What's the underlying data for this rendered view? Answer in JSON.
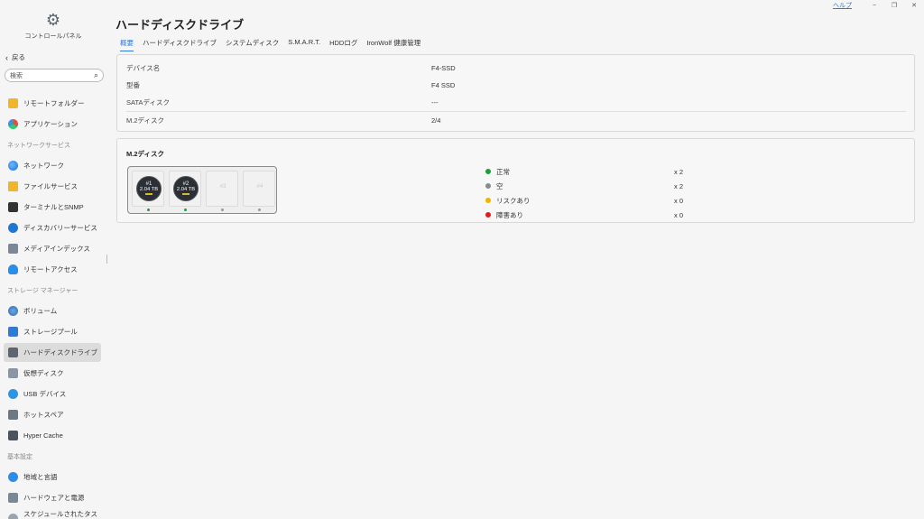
{
  "window": {
    "help": "ヘルプ",
    "minimize": "−",
    "restore": "❐",
    "close": "✕"
  },
  "sidebar": {
    "title": "コントロールパネル",
    "back": "戻る",
    "search_placeholder": "検索",
    "items": [
      {
        "type": "item",
        "label": "リモートフォルダー",
        "icon": "remote-folder-icon",
        "cls": "yellow"
      },
      {
        "type": "item",
        "label": "アプリケーション",
        "icon": "app-icon",
        "cls": "tri"
      },
      {
        "type": "section",
        "label": "ネットワークサービス"
      },
      {
        "type": "item",
        "label": "ネットワーク",
        "icon": "network-icon",
        "cls": "globe"
      },
      {
        "type": "item",
        "label": "ファイルサービス",
        "icon": "file-service-icon",
        "cls": "folder"
      },
      {
        "type": "item",
        "label": "ターミナルとSNMP",
        "icon": "terminal-icon",
        "cls": "term"
      },
      {
        "type": "item",
        "label": "ディスカバリーサービス",
        "icon": "discovery-icon",
        "cls": "disc"
      },
      {
        "type": "item",
        "label": "メディアインデックス",
        "icon": "media-index-icon",
        "cls": "media"
      },
      {
        "type": "item",
        "label": "リモートアクセス",
        "icon": "remote-access-icon",
        "cls": "cloud"
      },
      {
        "type": "section",
        "label": "ストレージ マネージャー"
      },
      {
        "type": "item",
        "label": "ボリューム",
        "icon": "volume-icon",
        "cls": "vol"
      },
      {
        "type": "item",
        "label": "ストレージプール",
        "icon": "storage-pool-icon",
        "cls": "pool"
      },
      {
        "type": "item",
        "label": "ハードディスクドライブ",
        "icon": "hdd-icon",
        "cls": "hdd",
        "active": true
      },
      {
        "type": "item",
        "label": "仮想ディスク",
        "icon": "virtual-disk-icon",
        "cls": "vdisk"
      },
      {
        "type": "item",
        "label": "USB デバイス",
        "icon": "usb-icon",
        "cls": "usb"
      },
      {
        "type": "item",
        "label": "ホットスペア",
        "icon": "hot-spare-icon",
        "cls": "spare"
      },
      {
        "type": "item",
        "label": "Hyper Cache",
        "icon": "hyper-cache-icon",
        "cls": "cache"
      },
      {
        "type": "section",
        "label": "基本設定"
      },
      {
        "type": "item",
        "label": "地域と言語",
        "icon": "region-icon",
        "cls": "region"
      },
      {
        "type": "item",
        "label": "ハードウェアと電源",
        "icon": "hardware-icon",
        "cls": "hw"
      },
      {
        "type": "item",
        "label": "スケジュールされたタスク",
        "icon": "schedule-icon",
        "cls": "sched"
      }
    ]
  },
  "main": {
    "title": "ハードディスクドライブ",
    "tabs": [
      "概要",
      "ハードディスクドライブ",
      "システムディスク",
      "S.M.A.R.T.",
      "HDDログ",
      "IronWolf 健康管理"
    ],
    "active_tab": 0,
    "info": [
      {
        "key": "デバイス名",
        "value": "F4-SSD"
      },
      {
        "key": "型番",
        "value": "F4 SSD"
      },
      {
        "key": "SATAディスク",
        "value": "---"
      },
      {
        "key": "M.2ディスク",
        "value": "2/4"
      }
    ],
    "m2": {
      "heading": "M.2ディスク",
      "slots": [
        {
          "num": "#1",
          "cap": "2.04 TB",
          "filled": true,
          "status": "green"
        },
        {
          "num": "#2",
          "cap": "2.04 TB",
          "filled": true,
          "status": "green"
        },
        {
          "num": "#3",
          "filled": false,
          "status": "gray"
        },
        {
          "num": "#4",
          "filled": false,
          "status": "gray"
        }
      ],
      "legend": [
        {
          "label": "正常",
          "count": "x 2",
          "color": "#1e9e3a"
        },
        {
          "label": "空",
          "count": "x 2",
          "color": "#8a8a8a"
        },
        {
          "label": "リスクあり",
          "count": "x 0",
          "color": "#f0b400"
        },
        {
          "label": "障害あり",
          "count": "x 0",
          "color": "#e01b1b"
        }
      ]
    }
  }
}
